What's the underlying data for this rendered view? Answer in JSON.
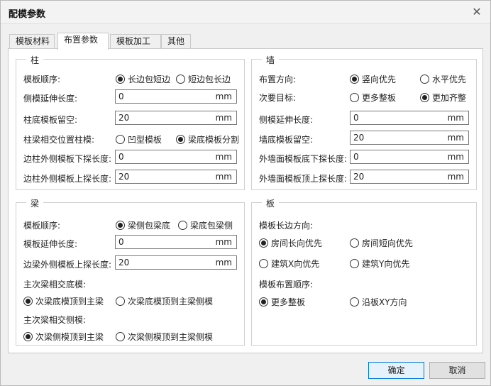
{
  "window": {
    "title": "配模参数",
    "close_glyph": "✕"
  },
  "tabs": [
    "模板材料",
    "布置参数",
    "模板加工",
    "其他"
  ],
  "column": {
    "title": "柱",
    "order_label": "模板顺序:",
    "order_opt1": "长边包短边",
    "order_opt2": "短边包长边",
    "side_extend_label": "侧模延伸长度:",
    "side_extend_value": "0",
    "bottom_gap_label": "柱底模板留空:",
    "bottom_gap_value": "20",
    "beam_joint_label": "柱梁相交位置柱模:",
    "beam_joint_opt1": "凹型模板",
    "beam_joint_opt2": "梁底模板分割",
    "outer_lower_label": "边柱外侧模板下探长度:",
    "outer_lower_value": "0",
    "outer_upper_label": "边柱外侧模板上探长度:",
    "outer_upper_value": "20",
    "unit": "mm"
  },
  "wall": {
    "title": "墙",
    "direction_label": "布置方向:",
    "direction_opt1": "竖向优先",
    "direction_opt2": "水平优先",
    "target_label": "次要目标:",
    "target_opt1": "更多整板",
    "target_opt2": "更加齐整",
    "side_extend_label": "侧模延伸长度:",
    "side_extend_value": "0",
    "bottom_gap_label": "墙底模板留空:",
    "bottom_gap_value": "20",
    "outer_lower_label": "外墙面模板底下探长度:",
    "outer_lower_value": "0",
    "outer_upper_label": "外墙面模板顶上探长度:",
    "outer_upper_value": "20",
    "unit": "mm"
  },
  "beam": {
    "title": "梁",
    "order_label": "模板顺序:",
    "order_opt1": "梁侧包梁底",
    "order_opt2": "梁底包梁侧",
    "extend_label": "模板延伸长度:",
    "extend_value": "0",
    "outer_upper_label": "边梁外侧模板上探长度:",
    "outer_upper_value": "20",
    "main_bottom_label": "主次梁相交底模:",
    "main_bottom_opt1": "次梁底模顶到主梁",
    "main_bottom_opt2": "次梁底模顶到主梁侧模",
    "main_side_label": "主次梁相交侧模:",
    "main_side_opt1": "次梁侧模顶到主梁",
    "main_side_opt2": "次梁侧模顶到主梁侧模",
    "unit": "mm"
  },
  "slab": {
    "title": "板",
    "long_dir_label": "模板长边方向:",
    "long_dir_opt1": "房间长向优先",
    "long_dir_opt2": "房间短向优先",
    "long_dir_opt3": "建筑X向优先",
    "long_dir_opt4": "建筑Y向优先",
    "layout_order_label": "模板布置顺序:",
    "layout_order_opt1": "更多整板",
    "layout_order_opt2": "沿板XY方向"
  },
  "buttons": {
    "ok": "确定",
    "cancel": "取消"
  }
}
